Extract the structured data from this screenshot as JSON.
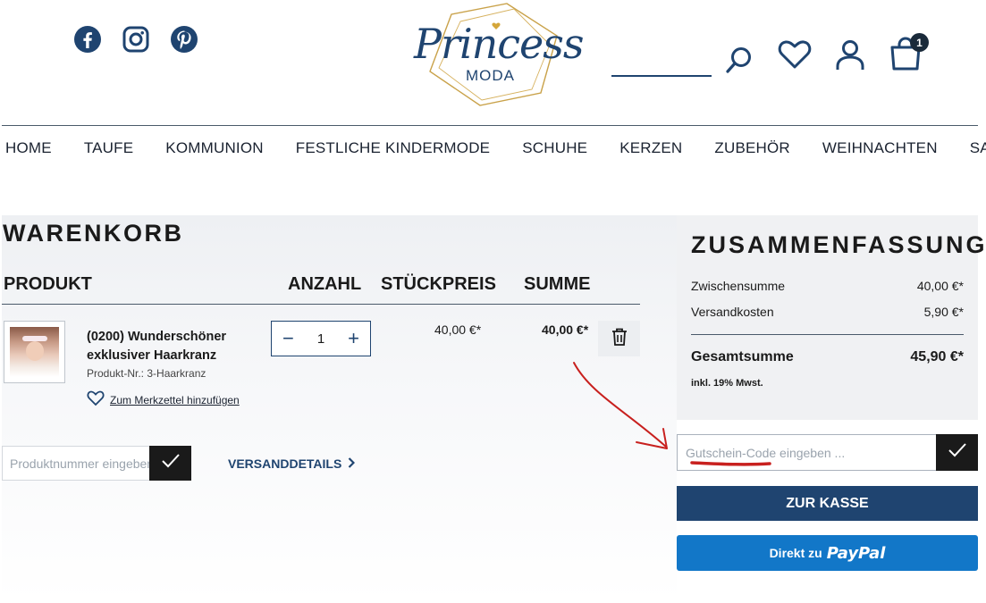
{
  "header": {
    "social": [
      "facebook-icon",
      "instagram-icon",
      "pinterest-icon"
    ],
    "logo_script": "Princess",
    "logo_sub": "MODA",
    "cart_count": "1"
  },
  "nav": [
    "HOME",
    "TAUFE",
    "KOMMUNION",
    "FESTLICHE KINDERMODE",
    "SCHUHE",
    "KERZEN",
    "ZUBEHÖR",
    "WEIHNACHTEN",
    "SALE %"
  ],
  "cart": {
    "title": "WARENKORB",
    "col_product": "PRODUKT",
    "col_qty": "ANZAHL",
    "col_unit": "STÜCKPREIS",
    "col_sum": "SUMME",
    "item": {
      "name": "(0200) Wunderschöner exklusiver Haarkranz",
      "product_nr": "Produkt-Nr.: 3-Haarkranz",
      "wishlist": "Zum Merkzettel hinzufügen",
      "qty": "1",
      "qty_minus": "−",
      "qty_plus": "+",
      "unit_price": "40,00 €*",
      "sum": "40,00 €*"
    },
    "prodnr_placeholder": "Produktnummer eingeben ...",
    "shipping_details": "VERSANDDETAILS"
  },
  "summary": {
    "title": "ZUSAMMENFASSUNG",
    "subtotal_label": "Zwischensumme",
    "subtotal": "40,00 €*",
    "shipping_label": "Versandkosten",
    "shipping": "5,90 €*",
    "total_label": "Gesamtsumme",
    "total": "45,90 €*",
    "vat_note": "inkl. 19% Mwst.",
    "voucher_placeholder": "Gutschein-Code eingeben ...",
    "checkout_label": "ZUR KASSE",
    "paypal_pre": "Direkt zu",
    "paypal_brand": "PayPal"
  },
  "colors": {
    "brand_navy": "#1f4470",
    "paypal_blue": "#1277c8",
    "annotation_red": "#c8201e"
  }
}
